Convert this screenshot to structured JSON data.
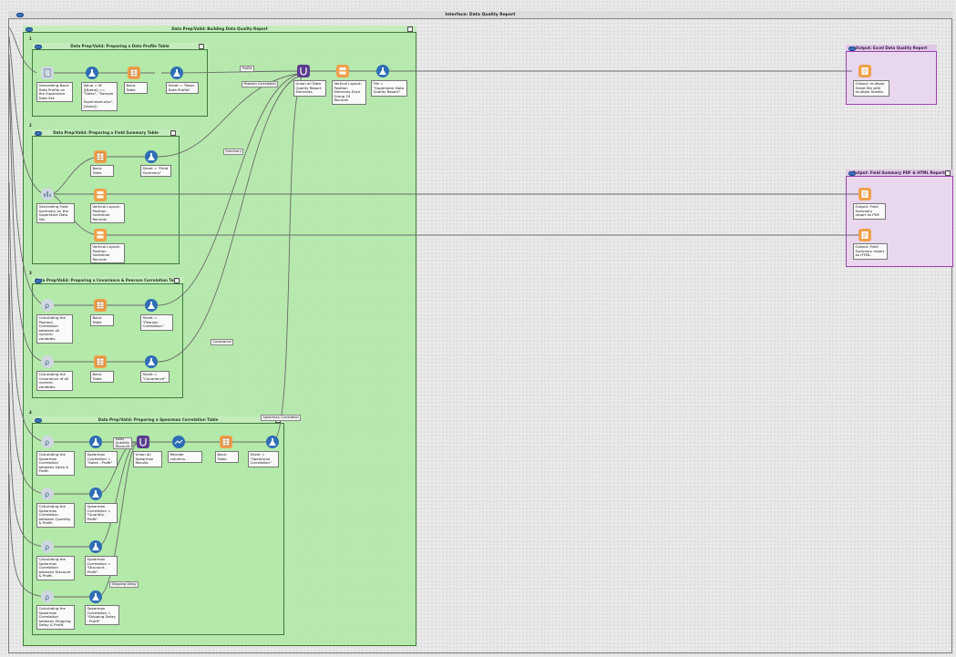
{
  "workflow": {
    "title": "Interface: Data Quality Report"
  },
  "main_container": {
    "title": "Data Prep/Valid: Building Data Quality Report"
  },
  "containers": {
    "profile": "Data Prep/Valid: Preparing a Data Profile Table",
    "summary": "Data Prep/Valid: Preparing a Field Summary Table",
    "covariance": "Data Prep/Valid: Preparing a Covariance & Pearson Correlation Table",
    "spearman": "Data Prep/Valid: Preparing a Spearman Correlation Table",
    "out_excel": "Output: Excel Data Quality Report",
    "out_pdf": "Output: Field Summary PDF & HTML Reports"
  },
  "markers": {
    "m1": "1",
    "m2": "2",
    "m3": "3",
    "m4": "4"
  },
  "connections": {
    "profile": "Profile",
    "pearson": "Pearson Correlation",
    "summary": "Summary",
    "covariance": "Covariance",
    "spearman": "Spearman Correlation",
    "sales_quantity_discount": "Sales\nQuantity\nDiscount",
    "shipping_delay": "Shipping Delay"
  },
  "tools": {
    "profile_gen": "Generating Basic Data Profile on the Superstore Data Set.",
    "profile_formula": "Value = IIF ([Name] == \"Sales\", \"Sample - Superstore.xlsx\", [Value])",
    "profile_table": "Basic Table",
    "profile_rename": "Sheet = \"Basic Data Profile\"",
    "union_report": "Union all Data Quality Report Elements",
    "vertical_layout": "Vertical Layout: Position Elements Each Group Of Records",
    "file_formula": "File = \"Superstore Data Quality Report\"",
    "summary_gen": "Generating Field Summary on the Superstore Data Set.",
    "summary_table": "Basic Table",
    "summary_rename": "Sheet = \"Field Summary\"",
    "summary_layout1": "Vertical Layout: Position Individual Records",
    "summary_layout2": "Vertical Layout: Position Individual Records",
    "pearson_calc": "Calculating the Pearson Correlation between all numeric variables.",
    "pearson_table": "Basic Table",
    "pearson_rename": "Sheet = \"Pearson Correlation\"",
    "cov_calc": "Calculating the Covariance of all numeric variables.",
    "cov_table": "Basic Table",
    "cov_rename": "Sheet = \"Covariance\"",
    "sp_sales_calc": "Calculating the Spearman Correlation between Sales & Profit.",
    "sp_sales_formula": "Spearman Correlation = \"Sales - Profit\"",
    "sp_quantity_calc": "Calculating the Spearman Correlation between Quantity & Profit.",
    "sp_quantity_formula": "Spearman Correlation = \"Quantity - Profit\"",
    "sp_discount_calc": "Calculating the Spearman Correlation between Discount & Profit.",
    "sp_discount_formula": "Spearman Correlation = \"Discount - Profit\"",
    "sp_shipping_calc": "Calculating the Spearman Correlation between Shipping Delay & Profit.",
    "sp_shipping_formula": "Spearman Correlation = \"Shipping Delay - Profit\"",
    "sp_union": "Union all Spearman Results",
    "sp_reorder": "Reorder columns.",
    "sp_table": "Basic Table",
    "sp_rename": "Sheet = \"Spearman Correlation\"",
    "out_excel": "Output: multiple Sheet file with multiple Sheets.",
    "out_pdf": "Output: Field Summary report as PDF.",
    "out_html": "Output: Field Summary report as HTML."
  },
  "colors": {
    "container_fill": "#b2e8a8",
    "container_border": "#3f7a3c",
    "output_fill": "#e9d7ee",
    "output_border": "#9b3fb3",
    "blue_tool": "#2f6db5",
    "orange_tool": "#f0a04b",
    "purple_tool": "#5b3d8f",
    "gray_tool": "#cfd8e0"
  },
  "icons": {
    "formula": "flask-icon",
    "table": "table-icon",
    "union": "union-icon",
    "layout": "layout-icon",
    "profile": "data-profile-icon",
    "summary": "field-summary-icon",
    "correlation": "correlation-icon",
    "reorder": "select-columns-icon",
    "render": "render-output-icon"
  }
}
